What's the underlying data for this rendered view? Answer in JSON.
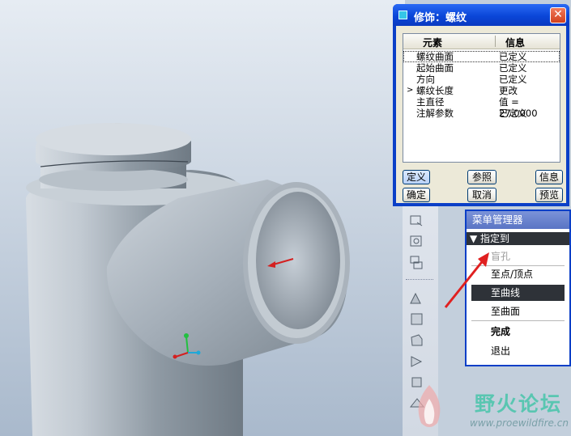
{
  "dialog": {
    "title": "修饰：螺纹",
    "close_label": "✕",
    "columns": {
      "element": "元素",
      "info": "信息"
    },
    "rows": [
      {
        "element": "螺纹曲面",
        "info": "已定义",
        "selected": true
      },
      {
        "element": "起始曲面",
        "info": "已定义"
      },
      {
        "element": "方向",
        "info": "已定义"
      },
      {
        "element": "螺纹长度",
        "info": "更改",
        "current": true
      },
      {
        "element": "主直径",
        "info": "值 = 27.0000"
      },
      {
        "element": "注解参数",
        "info": "已定义"
      }
    ],
    "current_marker": ">",
    "buttons": {
      "define": "定义",
      "reference": "参照",
      "info": "信息",
      "ok": "确定",
      "cancel": "取消",
      "preview": "预览"
    }
  },
  "menu": {
    "title": "菜单管理器",
    "submenu": "▼ 指定到",
    "items": [
      {
        "label": "盲孔",
        "state": "disabled"
      },
      {
        "label": "至点/顶点",
        "state": "normal"
      },
      {
        "label": "至曲线",
        "state": "highlight"
      },
      {
        "label": "至曲面",
        "state": "normal"
      }
    ],
    "done": "完成",
    "exit": "退出"
  },
  "watermark": {
    "text": "野火论坛",
    "url": "www.proewildfire.cn"
  },
  "colors": {
    "titlebar_blue": "#0a46d8",
    "highlight": "#2e3238",
    "annotation_red": "#e02020",
    "model_grey": "#a9b2ba"
  }
}
